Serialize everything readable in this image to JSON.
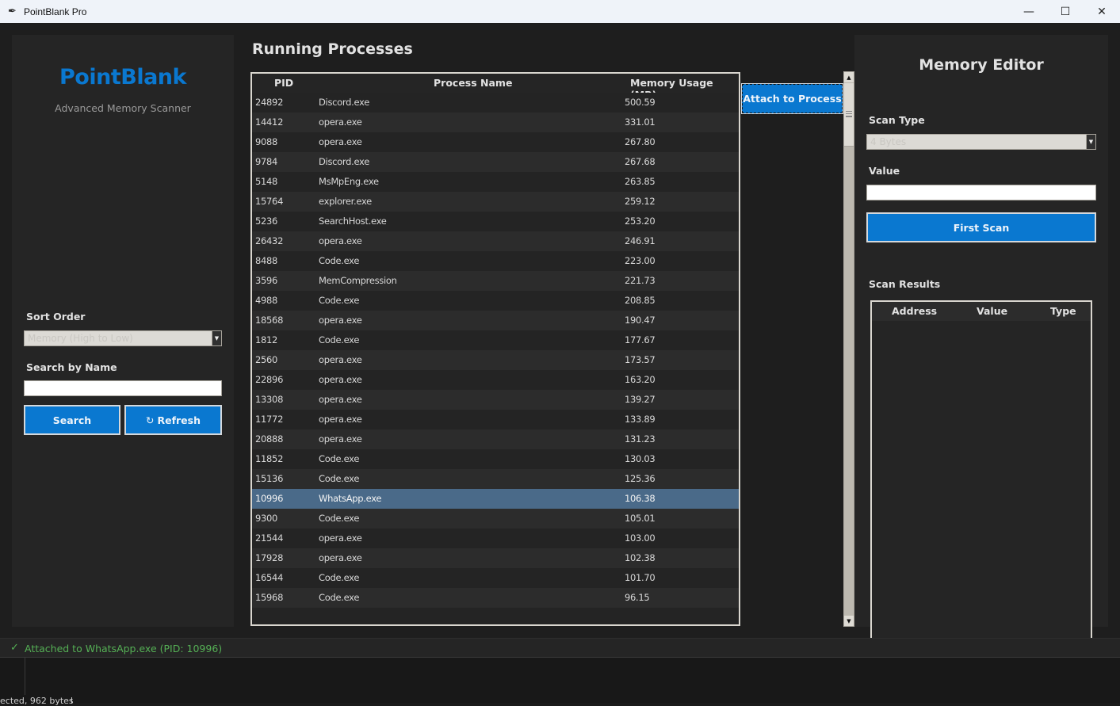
{
  "window": {
    "title": "PointBlank Pro",
    "app_icon": "feather-icon",
    "controls": {
      "minimize": "—",
      "maximize": "☐",
      "close": "✕"
    }
  },
  "sidebar": {
    "brand": "PointBlank",
    "subtitle": "Advanced Memory Scanner",
    "sort_label": "Sort Order",
    "sort_value": "Memory (High to Low)",
    "search_label": "Search by Name",
    "search_value": "",
    "search_button": "Search",
    "refresh_button": "Refresh",
    "refresh_icon": "↻"
  },
  "processes": {
    "title": "Running Processes",
    "columns": [
      "PID",
      "Process Name",
      "Memory Usage (MB)"
    ],
    "selected_pid": "10996",
    "rows": [
      {
        "pid": "24892",
        "name": "Discord.exe",
        "mem": "500.59"
      },
      {
        "pid": "14412",
        "name": "opera.exe",
        "mem": "331.01"
      },
      {
        "pid": "9088",
        "name": "opera.exe",
        "mem": "267.80"
      },
      {
        "pid": "9784",
        "name": "Discord.exe",
        "mem": "267.68"
      },
      {
        "pid": "5148",
        "name": "MsMpEng.exe",
        "mem": "263.85"
      },
      {
        "pid": "15764",
        "name": "explorer.exe",
        "mem": "259.12"
      },
      {
        "pid": "5236",
        "name": "SearchHost.exe",
        "mem": "253.20"
      },
      {
        "pid": "26432",
        "name": "opera.exe",
        "mem": "246.91"
      },
      {
        "pid": "8488",
        "name": "Code.exe",
        "mem": "223.00"
      },
      {
        "pid": "3596",
        "name": "MemCompression",
        "mem": "221.73"
      },
      {
        "pid": "4988",
        "name": "Code.exe",
        "mem": "208.85"
      },
      {
        "pid": "18568",
        "name": "opera.exe",
        "mem": "190.47"
      },
      {
        "pid": "1812",
        "name": "Code.exe",
        "mem": "177.67"
      },
      {
        "pid": "2560",
        "name": "opera.exe",
        "mem": "173.57"
      },
      {
        "pid": "22896",
        "name": "opera.exe",
        "mem": "163.20"
      },
      {
        "pid": "13308",
        "name": "opera.exe",
        "mem": "139.27"
      },
      {
        "pid": "11772",
        "name": "opera.exe",
        "mem": "133.89"
      },
      {
        "pid": "20888",
        "name": "opera.exe",
        "mem": "131.23"
      },
      {
        "pid": "11852",
        "name": "Code.exe",
        "mem": "130.03"
      },
      {
        "pid": "15136",
        "name": "Code.exe",
        "mem": "125.36"
      },
      {
        "pid": "10996",
        "name": "WhatsApp.exe",
        "mem": "106.38"
      },
      {
        "pid": "9300",
        "name": "Code.exe",
        "mem": "105.01"
      },
      {
        "pid": "21544",
        "name": "opera.exe",
        "mem": "103.00"
      },
      {
        "pid": "17928",
        "name": "opera.exe",
        "mem": "102.38"
      },
      {
        "pid": "16544",
        "name": "Code.exe",
        "mem": "101.70"
      },
      {
        "pid": "15968",
        "name": "Code.exe",
        "mem": "96.15"
      }
    ],
    "attach_button": "Attach to Process"
  },
  "editor": {
    "title": "Memory Editor",
    "scan_type_label": "Scan Type",
    "scan_type_value": "4 Bytes",
    "value_label": "Value",
    "value": "",
    "first_scan_button": "First Scan",
    "results_label": "Scan Results",
    "results_columns": [
      "Address",
      "Value",
      "Type"
    ],
    "results_rows": []
  },
  "status": {
    "icon": "✓",
    "text": "Attached to WhatsApp.exe (PID: 10996)"
  },
  "background_terminal": {
    "text": "ected, 962 bytes"
  },
  "colors": {
    "accent": "#0a78d0",
    "status_ok": "#55b055",
    "selection": "#4a6a89"
  }
}
